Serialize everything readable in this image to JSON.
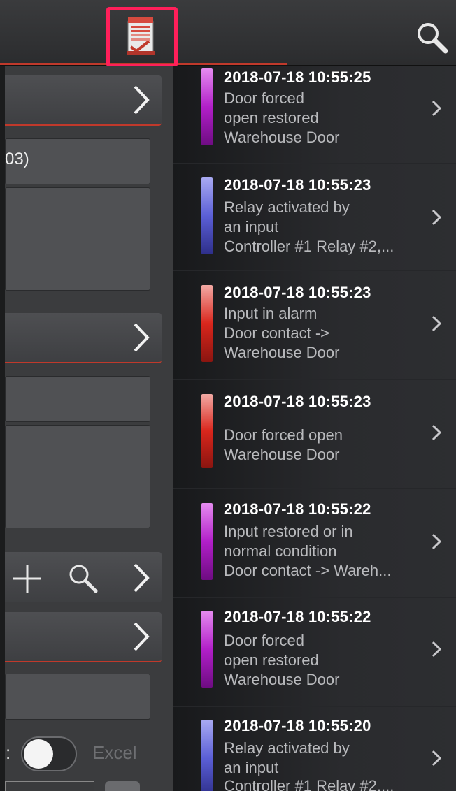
{
  "left_panel": {
    "partial_value": "03)",
    "toggle_label": "Excel"
  },
  "events": [
    {
      "time": "2018-07-18  10:55:25",
      "lines": [
        "Door forced",
        "open restored",
        "Warehouse Door"
      ],
      "color": "#b21fc9"
    },
    {
      "time": "2018-07-18  10:55:23",
      "lines": [
        "Relay activated by",
        "an input",
        "Controller #1 Relay #2,..."
      ],
      "color": "#5b5fd6"
    },
    {
      "time": "2018-07-18  10:55:23",
      "lines": [
        "Input in alarm",
        "Door contact ->",
        "Warehouse Door"
      ],
      "color": "#d9261c"
    },
    {
      "time": "2018-07-18  10:55:23",
      "lines": [
        "",
        "Door forced open",
        "Warehouse Door"
      ],
      "color": "#d9261c"
    },
    {
      "time": "2018-07-18  10:55:22",
      "lines": [
        "Input restored or in",
        "normal condition",
        "Door contact -> Wareh..."
      ],
      "color": "#b21fc9"
    },
    {
      "time": "2018-07-18  10:55:22",
      "lines": [
        "Door forced",
        "open restored",
        "Warehouse Door"
      ],
      "color": "#b21fc9"
    },
    {
      "time": "2018-07-18  10:55:20",
      "lines": [
        "Relay activated by",
        "an input",
        "Controller #1 Relay #2,..."
      ],
      "color": "#5b5fd6"
    }
  ],
  "icons": {
    "app": "report-app-icon",
    "search": "search-icon",
    "chevron": "chevron-right-icon",
    "add": "plus-icon"
  }
}
